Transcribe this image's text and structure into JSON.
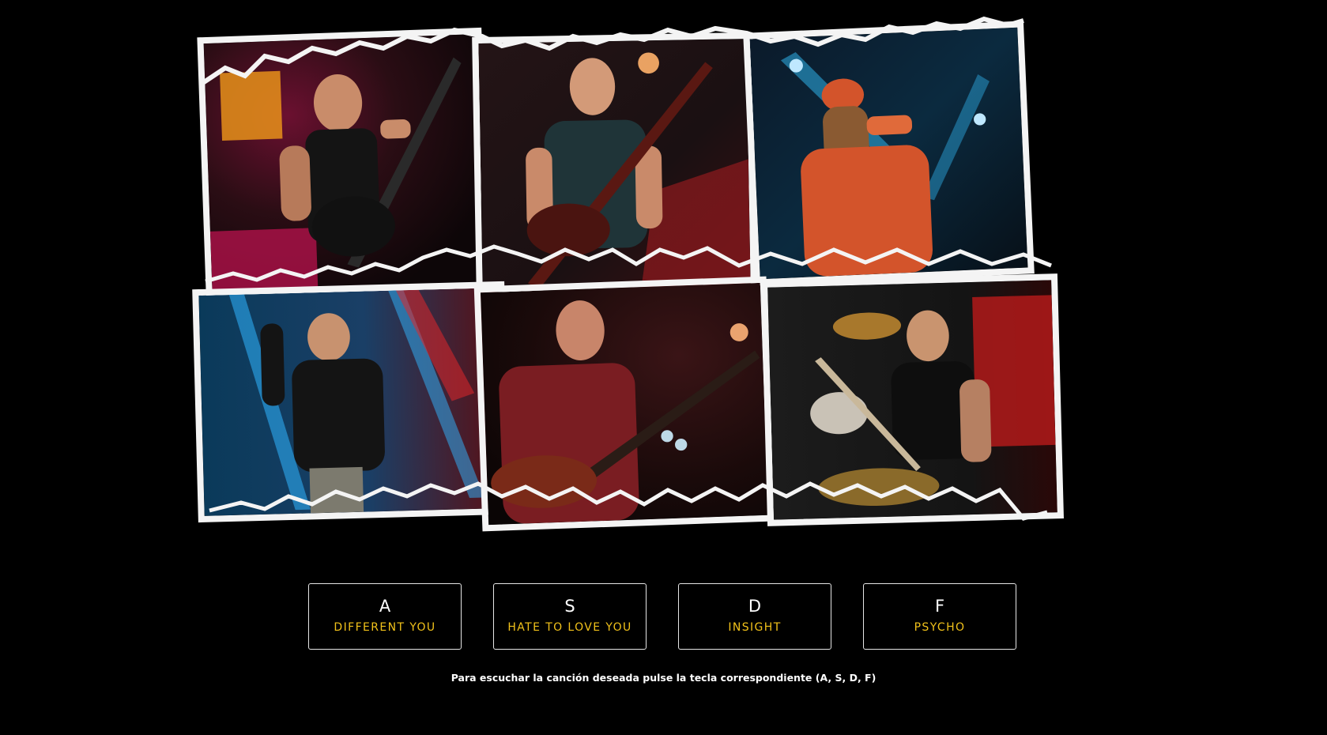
{
  "collage": {
    "photos": [
      {
        "name": "photo-guitarist-shouting",
        "subject": "guitarist in sleeveless shirt shouting with guitar",
        "colors": {
          "bg": "#2a0d14",
          "accent": "#b0124a",
          "skin": "#c98c6a"
        }
      },
      {
        "name": "photo-bassist",
        "subject": "bald bassist playing bass",
        "colors": {
          "bg": "#1a1012",
          "accent": "#8a1a1e",
          "skin": "#d39a78"
        }
      },
      {
        "name": "photo-singer-long-hair",
        "subject": "long-haired singer in red shirt with microphone",
        "colors": {
          "bg": "#0b2a3f",
          "accent": "#2fb0e8",
          "skin": "#d3542b"
        }
      },
      {
        "name": "photo-singer-blue-lights",
        "subject": "singer with cap under blue and red lights",
        "colors": {
          "bg": "#0a3a5a",
          "accent": "#2fb5ff",
          "skin": "#141414"
        }
      },
      {
        "name": "photo-guitarist-red-shirt",
        "subject": "guitarist in red shirt playing guitar",
        "colors": {
          "bg": "#1a0a0a",
          "accent": "#7a1d22",
          "skin": "#c8856a"
        }
      },
      {
        "name": "photo-drummer",
        "subject": "drummer with headphones playing drums",
        "colors": {
          "bg": "#141414",
          "accent": "#b11a1a",
          "skin": "#c9946f"
        }
      }
    ]
  },
  "keys": [
    {
      "letter": "A",
      "song": "DIFFERENT YOU"
    },
    {
      "letter": "S",
      "song": "HATE TO LOVE YOU"
    },
    {
      "letter": "D",
      "song": "INSIGHT"
    },
    {
      "letter": "F",
      "song": "PSYCHO"
    }
  ],
  "hint": {
    "text": "Para escuchar la canción deseada pulse la tecla correspondiente (A, S, D, F)"
  },
  "colors": {
    "background": "#000000",
    "key_border": "#e6e6e6",
    "letter": "#ffffff",
    "song": "#f2c21a",
    "paper": "#f4f4f4"
  }
}
